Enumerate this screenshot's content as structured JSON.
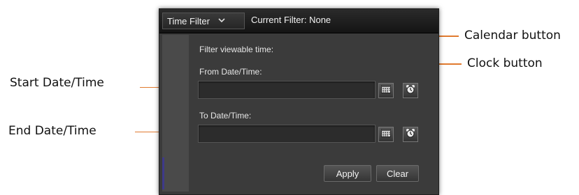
{
  "toolbar": {
    "dropdown_label": "Time Filter",
    "current_filter": "Current Filter: None"
  },
  "form": {
    "heading": "Filter viewable time:",
    "from_label": "From Date/Time:",
    "from_value": "",
    "to_label": "To Date/Time:",
    "to_value": ""
  },
  "buttons": {
    "apply": "Apply",
    "clear": "Clear"
  },
  "callouts": {
    "start": "Start Date/Time",
    "end": "End Date/Time",
    "calendar": "Calendar button",
    "clock": "Clock button"
  },
  "icons": {
    "dropdown": "chevron-down-icon",
    "calendar": "calendar-icon",
    "clock": "alarm-clock-icon"
  },
  "colors": {
    "leader": "#e07a2e",
    "panel": "#3b3b3b"
  }
}
